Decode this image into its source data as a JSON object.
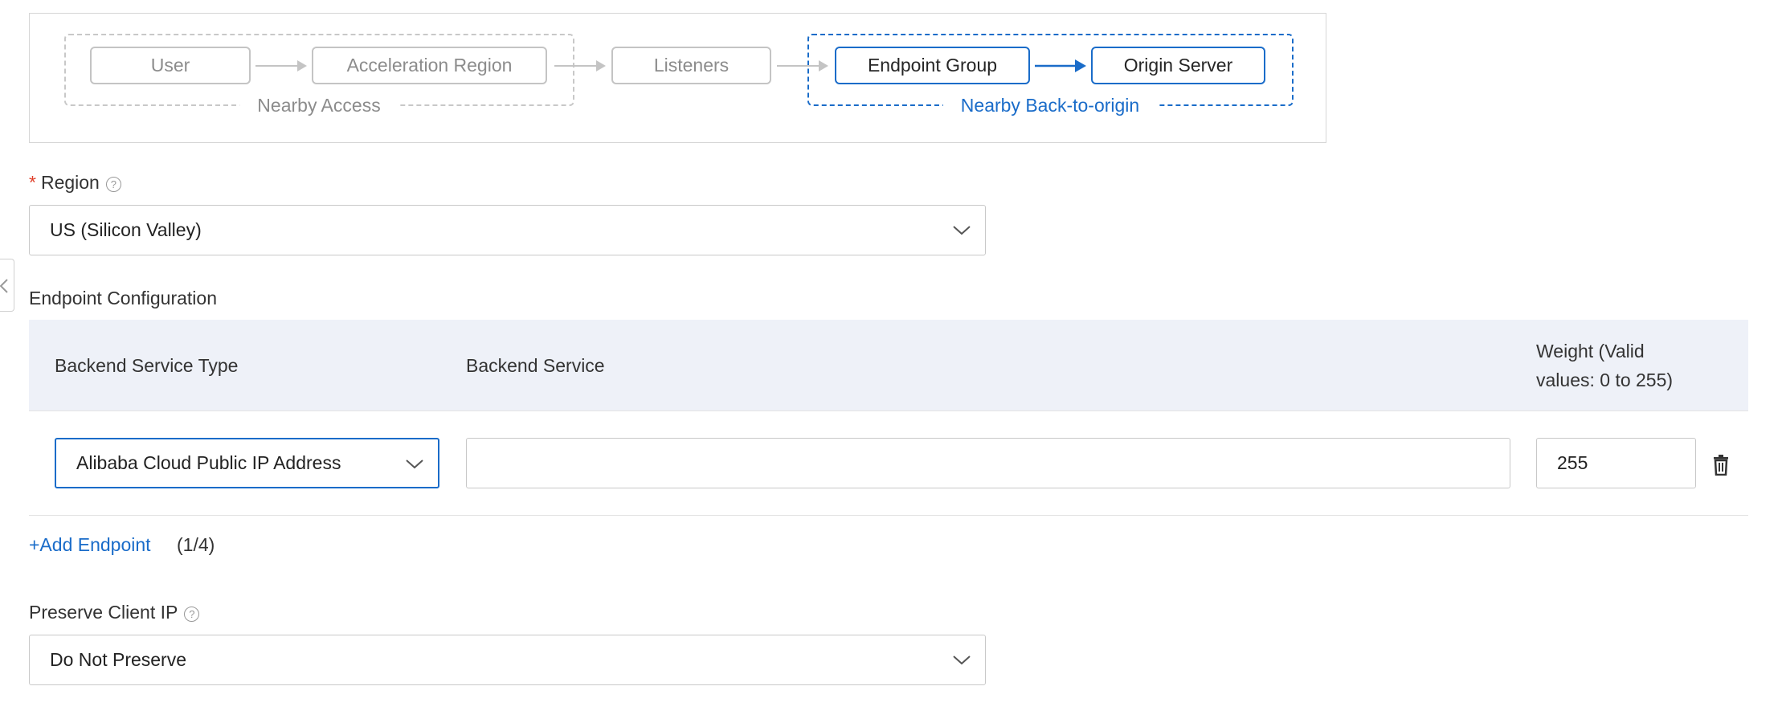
{
  "diagram": {
    "nodes": {
      "user": "User",
      "acceleration_region": "Acceleration Region",
      "listeners": "Listeners",
      "endpoint_group": "Endpoint Group",
      "origin_server": "Origin Server"
    },
    "group_nearby_access": "Nearby Access",
    "group_nearby_back_to_origin": "Nearby Back-to-origin"
  },
  "region": {
    "label": "Region",
    "required_mark": "*",
    "value": "US (Silicon Valley)"
  },
  "endpoint_configuration": {
    "title": "Endpoint Configuration",
    "columns": {
      "backend_service_type": "Backend Service Type",
      "backend_service": "Backend Service",
      "weight_line1": "Weight (Valid",
      "weight_line2": "values: 0 to 255)"
    },
    "rows": [
      {
        "backend_service_type": "Alibaba Cloud Public IP Address",
        "backend_service": "",
        "weight": "255"
      }
    ],
    "add_endpoint_label": "+Add Endpoint",
    "count": "(1/4)"
  },
  "preserve_client_ip": {
    "label": "Preserve Client IP",
    "value": "Do Not Preserve"
  },
  "help_icon_glyph": "?",
  "colors": {
    "accent": "#1a6cc9",
    "table_header_bg": "#eef1f8",
    "required": "#e0402b"
  },
  "icons": [
    "chevron-down-icon",
    "help-icon",
    "trash-icon",
    "arrow-right-icon",
    "chevron-left-icon"
  ]
}
